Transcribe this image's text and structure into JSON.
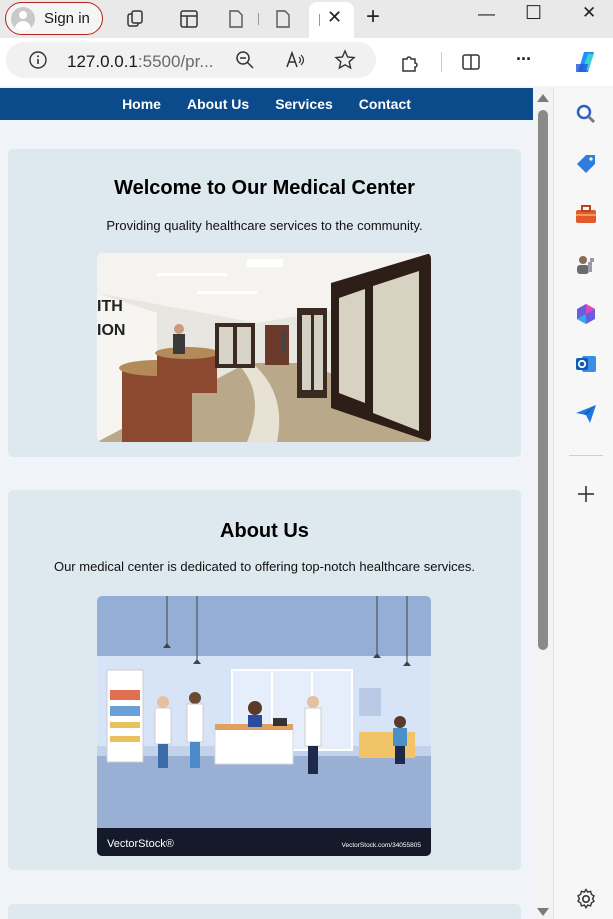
{
  "browser": {
    "sign_in_label": "Sign in",
    "url_host": "127.0.0.1",
    "url_rest": ":5500/pr...",
    "tab_close": "✕",
    "new_tab": "+",
    "minimize": "—",
    "maximize": "☐",
    "close": "✕",
    "more": "···"
  },
  "nav": {
    "items": [
      "Home",
      "About Us",
      "Services",
      "Contact"
    ],
    "bg_color": "#0b4a8b"
  },
  "hero": {
    "title": "Welcome to Our Medical Center",
    "subtitle": "Providing quality healthcare services to the community.",
    "sign_text": "ITH ION"
  },
  "about": {
    "title": "About Us",
    "text": "Our medical center is dedicated to offering top-notch healthcare services.",
    "watermark_left": "VectorStock®",
    "watermark_right": "VectorStock.com/34055805"
  },
  "sidebar": {
    "icons": [
      "search-icon",
      "tag-icon",
      "toolbox-icon",
      "games-icon",
      "copilot-icon",
      "outlook-icon",
      "send-icon",
      "add-icon",
      "settings-icon"
    ]
  }
}
